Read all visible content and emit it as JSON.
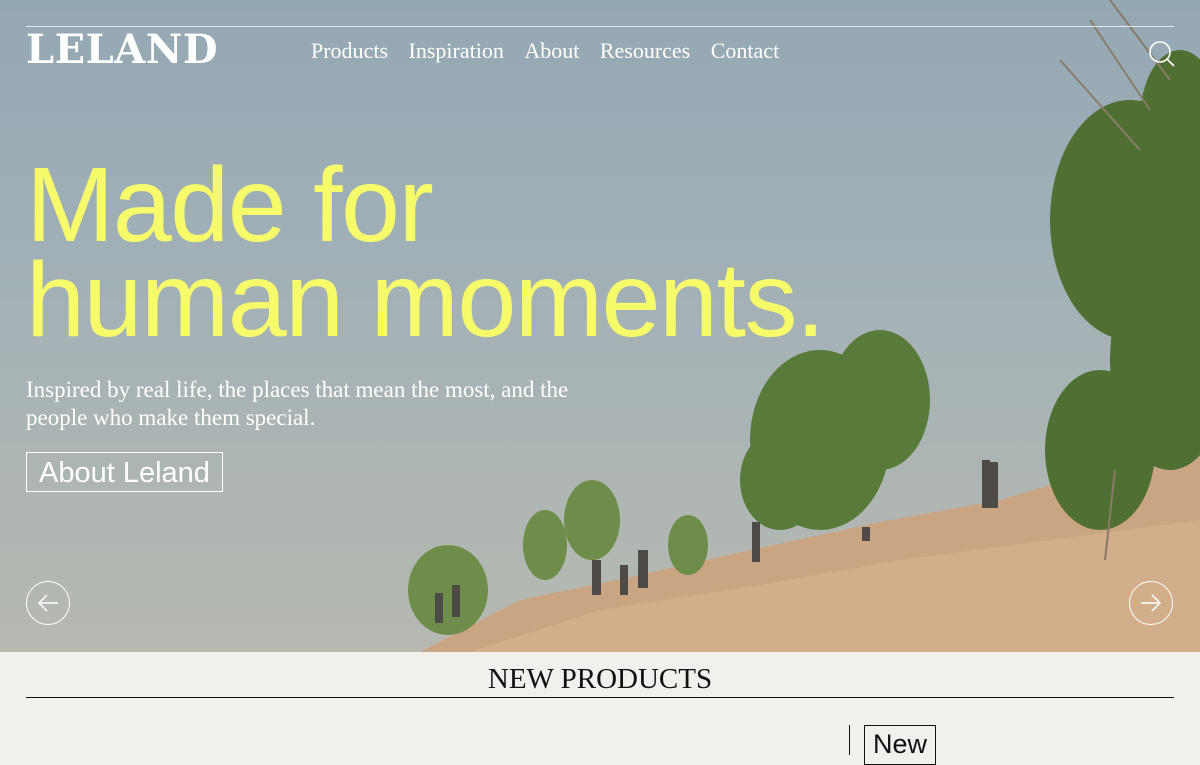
{
  "brand": {
    "logo_text": "LELAND"
  },
  "nav": {
    "items": [
      {
        "label": "Products"
      },
      {
        "label": "Inspiration"
      },
      {
        "label": "About"
      },
      {
        "label": "Resources"
      },
      {
        "label": "Contact"
      }
    ]
  },
  "icons": {
    "search": "search-icon",
    "prev": "arrow-left-icon",
    "next": "arrow-right-icon"
  },
  "hero": {
    "headline_line1": "Made for",
    "headline_line2": "human moments.",
    "subtext": "Inspired by real life, the places that mean the most, and the people who make them special.",
    "cta_label": "About Leland",
    "headline_color": "#f6fb6a"
  },
  "products": {
    "section_title": "NEW PRODUCTS",
    "badge": "New"
  }
}
